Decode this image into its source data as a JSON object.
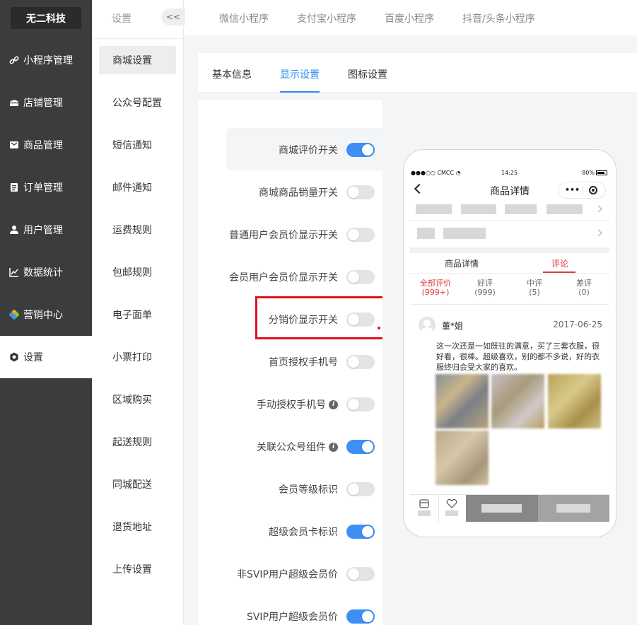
{
  "brand": "无二科技",
  "left_nav": [
    {
      "label": "小程序管理",
      "icon": "link-icon",
      "active": false
    },
    {
      "label": "店铺管理",
      "icon": "store-icon",
      "active": false
    },
    {
      "label": "商品管理",
      "icon": "box-icon",
      "active": false
    },
    {
      "label": "订单管理",
      "icon": "clipboard-icon",
      "active": false
    },
    {
      "label": "用户管理",
      "icon": "user-icon",
      "active": false
    },
    {
      "label": "数据统计",
      "icon": "chart-icon",
      "active": false
    },
    {
      "label": "营销中心",
      "icon": "puzzle-icon",
      "active": false
    },
    {
      "label": "设置",
      "icon": "gear-icon",
      "active": true
    }
  ],
  "sub_nav": {
    "title": "设置",
    "collapse_label": "<<",
    "items": [
      {
        "label": "商城设置",
        "active": true
      },
      {
        "label": "公众号配置"
      },
      {
        "label": "短信通知"
      },
      {
        "label": "邮件通知"
      },
      {
        "label": "运费规则"
      },
      {
        "label": "包邮规则"
      },
      {
        "label": "电子面单"
      },
      {
        "label": "小票打印"
      },
      {
        "label": "区域购买"
      },
      {
        "label": "起送规则"
      },
      {
        "label": "同城配送"
      },
      {
        "label": "退货地址"
      },
      {
        "label": "上传设置"
      }
    ]
  },
  "top_tabs": [
    "微信小程序",
    "支付宝小程序",
    "百度小程序",
    "抖音/头条小程序"
  ],
  "inner_tabs": [
    {
      "label": "基本信息",
      "active": false
    },
    {
      "label": "显示设置",
      "active": true
    },
    {
      "label": "图标设置",
      "active": false
    }
  ],
  "switches": [
    {
      "label": "商城评价开关",
      "on": true,
      "info": false
    },
    {
      "label": "商城商品销量开关",
      "on": false,
      "info": false
    },
    {
      "label": "普通用户会员价显示开关",
      "on": false,
      "info": false
    },
    {
      "label": "会员用户会员价显示开关",
      "on": false,
      "info": false
    },
    {
      "label": "分销价显示开关",
      "on": false,
      "info": false
    },
    {
      "label": "首页授权手机号",
      "on": false,
      "info": false
    },
    {
      "label": "手动授权手机号",
      "on": false,
      "info": true
    },
    {
      "label": "关联公众号组件",
      "on": true,
      "info": true
    },
    {
      "label": "会员等级标识",
      "on": false,
      "info": false
    },
    {
      "label": "超级会员卡标识",
      "on": true,
      "info": false
    },
    {
      "label": "非SVIP用户超级会员价",
      "on": false,
      "info": false
    },
    {
      "label": "SVIP用户超级会员价",
      "on": true,
      "info": false
    }
  ],
  "info_glyph": "i",
  "phone": {
    "carrier": "●●●○○ CMCC",
    "time": "14:25",
    "battery": "80%",
    "nav_title": "商品详情",
    "capsule_dots": "•••",
    "tabs": [
      {
        "label": "商品详情",
        "active": false
      },
      {
        "label": "评论",
        "active": true
      }
    ],
    "ratings": [
      {
        "label": "全部评价",
        "count": "(999+)",
        "active": true
      },
      {
        "label": "好评",
        "count": "(999)",
        "active": false
      },
      {
        "label": "中评",
        "count": "(5)",
        "active": false
      },
      {
        "label": "差评",
        "count": "(0)",
        "active": false
      }
    ],
    "review": {
      "name": "董*姐",
      "date": "2017-06-25",
      "text": "这一次还是一如既往的满意，买了三套衣服，很好看，很棒。超级喜欢，别的都不多说，好的衣服终归会受大家的喜欢。"
    }
  },
  "colors": {
    "nav_bg": "#3c3c3c",
    "accent": "#2d8cf0",
    "switch_on": "#3d8ff5",
    "highlight_red": "#e4101a",
    "review_red": "#e4393c"
  }
}
